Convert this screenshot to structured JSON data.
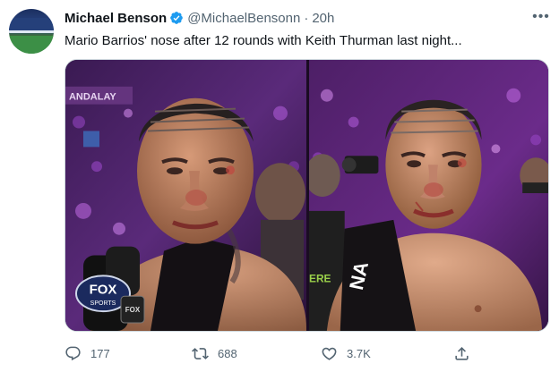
{
  "tweet": {
    "author_name": "Michael Benson",
    "handle": "@MichaelBensonn",
    "separator": "·",
    "time": "20h",
    "verified": true,
    "text": "Mario Barrios' nose after 12 rounds with Keith Thurman last night...",
    "more_icon": "more-horizontal-icon"
  },
  "media": {
    "left_photo": {
      "banner_text": "ANDALAY",
      "mic_logo": "FOX",
      "mic_logo_sub": "SPORTS",
      "mic_badge": "FOX"
    },
    "right_photo": {
      "towel_text": "NA",
      "corner_text": "ERE"
    }
  },
  "actions": {
    "reply_count": "177",
    "retweet_count": "688",
    "like_count": "3.7K",
    "icons": [
      "reply-icon",
      "retweet-icon",
      "like-icon",
      "share-icon"
    ]
  },
  "colors": {
    "verified_blue": "#1d9bf0",
    "secondary_text": "#536471",
    "primary_text": "#0f1419"
  }
}
